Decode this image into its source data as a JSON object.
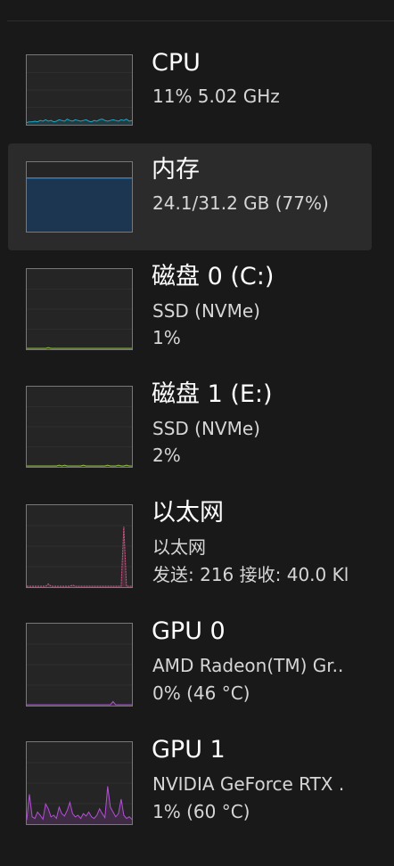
{
  "items": [
    {
      "key": "cpu",
      "title": "CPU",
      "lines": [
        "11%  5.02 GHz"
      ],
      "color": "#17a9c9",
      "series": [
        2,
        3,
        3,
        4,
        3,
        5,
        4,
        6,
        4,
        5,
        3,
        4,
        6,
        5,
        4,
        7,
        5,
        4,
        6,
        5,
        4,
        5,
        6,
        4,
        3,
        5,
        4,
        6,
        7,
        5,
        4,
        5,
        6,
        5,
        4,
        6,
        5,
        7,
        4,
        5
      ],
      "scale_max": 100,
      "selected": false
    },
    {
      "key": "memory",
      "title": "内存",
      "lines": [
        "24.1/31.2 GB (77%)"
      ],
      "color": "#3c8fd6",
      "fill_level": 77,
      "selected": true
    },
    {
      "key": "disk0",
      "title": "磁盘 0 (C:)",
      "lines": [
        "SSD (NVMe)",
        "1%"
      ],
      "color": "#8fbf3a",
      "series": [
        0,
        0,
        0,
        0,
        0,
        0,
        0,
        0,
        1,
        0,
        0,
        0,
        0,
        0,
        0,
        0,
        0,
        0,
        0,
        0,
        0,
        0,
        0,
        0,
        0,
        0,
        0,
        0,
        0,
        0,
        0,
        0,
        0,
        0,
        0,
        0,
        0,
        0,
        0,
        0
      ],
      "scale_max": 100,
      "selected": false
    },
    {
      "key": "disk1",
      "title": "磁盘 1 (E:)",
      "lines": [
        "SSD (NVMe)",
        "2%"
      ],
      "color": "#8fbf3a",
      "series": [
        0,
        0,
        0,
        0,
        0,
        0,
        0,
        0,
        0,
        0,
        0,
        0,
        1,
        0,
        1,
        0,
        0,
        0,
        0,
        0,
        0,
        1,
        0,
        0,
        0,
        0,
        0,
        0,
        0,
        0,
        1,
        0,
        0,
        0,
        1,
        0,
        0,
        1,
        0,
        0
      ],
      "scale_max": 100,
      "selected": false
    },
    {
      "key": "ethernet",
      "title": "以太网",
      "lines": [
        "以太网",
        "发送: 216 接收: 40.0 Kl"
      ],
      "color": "#d65a8c",
      "series": [
        0,
        0,
        0,
        0,
        0,
        0,
        0,
        0,
        2,
        0,
        0,
        0,
        0,
        0,
        0,
        0,
        0,
        1,
        0,
        0,
        0,
        0,
        0,
        0,
        0,
        0,
        0,
        0,
        0,
        0,
        0,
        0,
        0,
        0,
        0,
        0,
        52,
        0,
        0,
        0
      ],
      "scale_max": 70,
      "selected": false
    },
    {
      "key": "gpu0",
      "title": "GPU 0",
      "lines": [
        "AMD Radeon(TM) Gr..",
        "0% (46 °C)"
      ],
      "color": "#b44fd6",
      "series": [
        0,
        0,
        0,
        0,
        0,
        0,
        0,
        0,
        0,
        0,
        0,
        0,
        0,
        0,
        0,
        0,
        0,
        0,
        0,
        0,
        0,
        0,
        0,
        0,
        0,
        0,
        0,
        0,
        0,
        0,
        0,
        0,
        4,
        0,
        0,
        0,
        0,
        0,
        0,
        0
      ],
      "scale_max": 100,
      "selected": false
    },
    {
      "key": "gpu1",
      "title": "GPU 1",
      "lines": [
        "NVIDIA GeForce RTX .",
        "1% (60 °C)"
      ],
      "color": "#b44fd6",
      "series": [
        4,
        36,
        8,
        6,
        14,
        10,
        5,
        24,
        18,
        8,
        10,
        6,
        20,
        12,
        9,
        16,
        26,
        12,
        8,
        10,
        6,
        12,
        9,
        14,
        8,
        6,
        10,
        18,
        12,
        7,
        46,
        20,
        14,
        8,
        12,
        30,
        10,
        6,
        8,
        5
      ],
      "scale_max": 100,
      "selected": false
    }
  ]
}
